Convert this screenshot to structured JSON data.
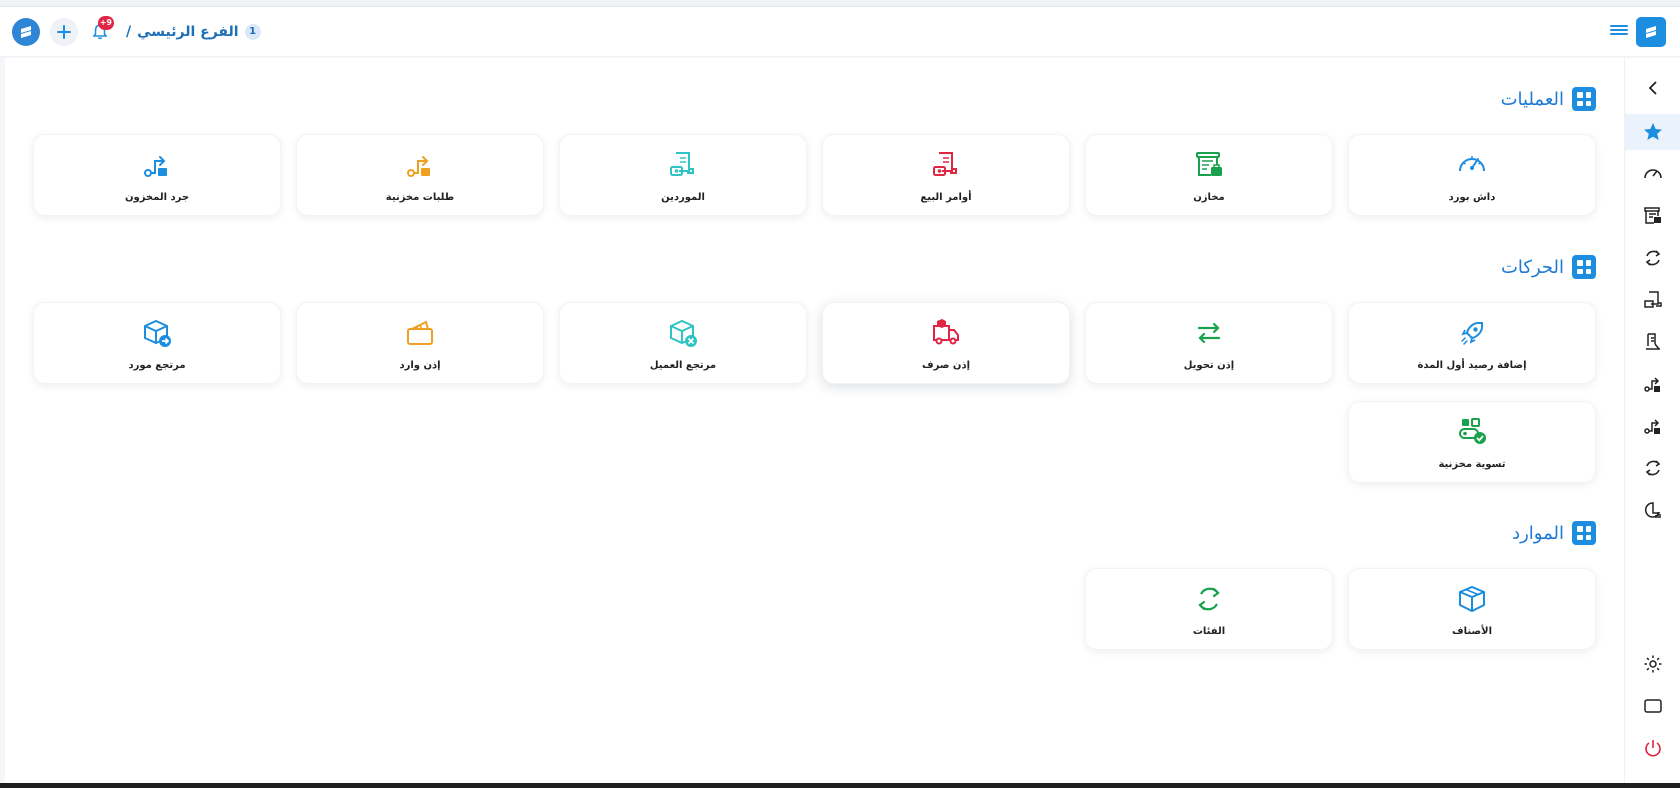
{
  "header": {
    "branch_number": "1",
    "branch_name": "الفرع الرئيسي",
    "separator": "/",
    "notification_count": "+9"
  },
  "sections": [
    {
      "title": "العمليات",
      "cards": [
        {
          "label": "داش بورد",
          "icon": "dashboard-gauge-icon",
          "color": "#1d8de0"
        },
        {
          "label": "مخازن",
          "icon": "warehouse-icon",
          "color": "#1aa14d"
        },
        {
          "label": "أوامر البيع",
          "icon": "sales-order-icon",
          "color": "#e02545"
        },
        {
          "label": "الموردين",
          "icon": "suppliers-icon",
          "color": "#2ec4c4"
        },
        {
          "label": "طلبات مخزنية",
          "icon": "stock-request-icon",
          "color": "#f0a020"
        },
        {
          "label": "جرد المخزون",
          "icon": "stock-count-icon",
          "color": "#1d8de0"
        }
      ]
    },
    {
      "title": "الحركات",
      "cards": [
        {
          "label": "إضافة رصيد أول المدة",
          "icon": "rocket-icon",
          "color": "#1d8de0"
        },
        {
          "label": "إذن تحويل",
          "icon": "transfer-arrows-icon",
          "color": "#1aa14d"
        },
        {
          "label": "إذن صرف",
          "icon": "delivery-truck-icon",
          "color": "#e02545"
        },
        {
          "label": "مرتجع العميل",
          "icon": "box-return-icon",
          "color": "#2ec4c4"
        },
        {
          "label": "إذن وارد",
          "icon": "inbound-folder-icon",
          "color": "#f0a020"
        },
        {
          "label": "مرتجع مورد",
          "icon": "supplier-return-icon",
          "color": "#1d8de0"
        },
        {
          "label": "تسوية مخزنية",
          "icon": "stock-adjust-icon",
          "color": "#1aa14d"
        }
      ]
    },
    {
      "title": "الموارد",
      "cards": [
        {
          "label": "الأصناف",
          "icon": "item-box-icon",
          "color": "#1d8de0"
        },
        {
          "label": "الفئات",
          "icon": "categories-refresh-icon",
          "color": "#1aa14d"
        }
      ]
    }
  ],
  "sidebar": {
    "items": [
      "collapse-chevron-icon",
      "favorites-star-icon",
      "dashboard-icon",
      "warehouse-icon",
      "refresh-icon",
      "sales-icon",
      "inventory-icon",
      "transfer-icon",
      "transfer-out-icon",
      "refresh-icon",
      "reports-chart-icon"
    ],
    "bottom": [
      "settings-gear-icon",
      "window-icon",
      "power-icon"
    ]
  },
  "colors": {
    "accent": "#1d8de0",
    "danger": "#e02545",
    "success": "#1aa14d",
    "warning": "#f0a020",
    "teal": "#2ec4c4"
  }
}
